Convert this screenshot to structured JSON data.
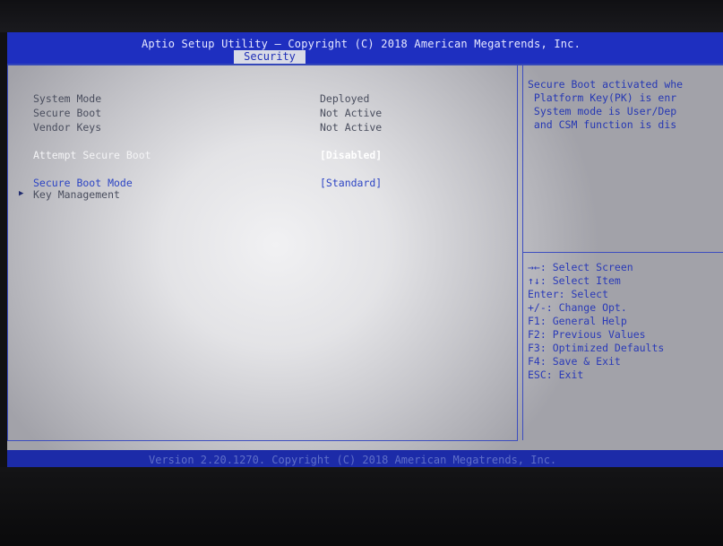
{
  "header": {
    "title": "Aptio Setup Utility – Copyright (C) 2018 American Megatrends, Inc.",
    "active_tab": "Security"
  },
  "settings": {
    "system_mode": {
      "label": "System Mode",
      "value": "Deployed"
    },
    "secure_boot": {
      "label": "Secure Boot",
      "value": "Not Active"
    },
    "vendor_keys": {
      "label": "Vendor Keys",
      "value": "Not Active"
    },
    "attempt_secure_boot": {
      "label": "Attempt Secure Boot",
      "value": "[Disabled]"
    },
    "secure_boot_mode": {
      "label": "Secure Boot Mode",
      "value": "[Standard]"
    },
    "key_management": {
      "label": "Key Management"
    }
  },
  "help": {
    "lines": [
      "Secure Boot activated whe",
      " Platform Key(PK) is enr",
      " System mode is User/Dep",
      " and CSM function is dis"
    ]
  },
  "keys": {
    "select_screen": "→←: Select Screen",
    "select_item": "↑↓: Select Item",
    "enter": "Enter: Select",
    "change": "+/-: Change Opt.",
    "f1": "F1: General Help",
    "f2": "F2: Previous Values",
    "f3": "F3: Optimized Defaults",
    "f4": "F4: Save & Exit",
    "esc": "ESC: Exit"
  },
  "footer": {
    "version": "Version 2.20.1270. Copyright (C) 2018 American Megatrends, Inc."
  }
}
